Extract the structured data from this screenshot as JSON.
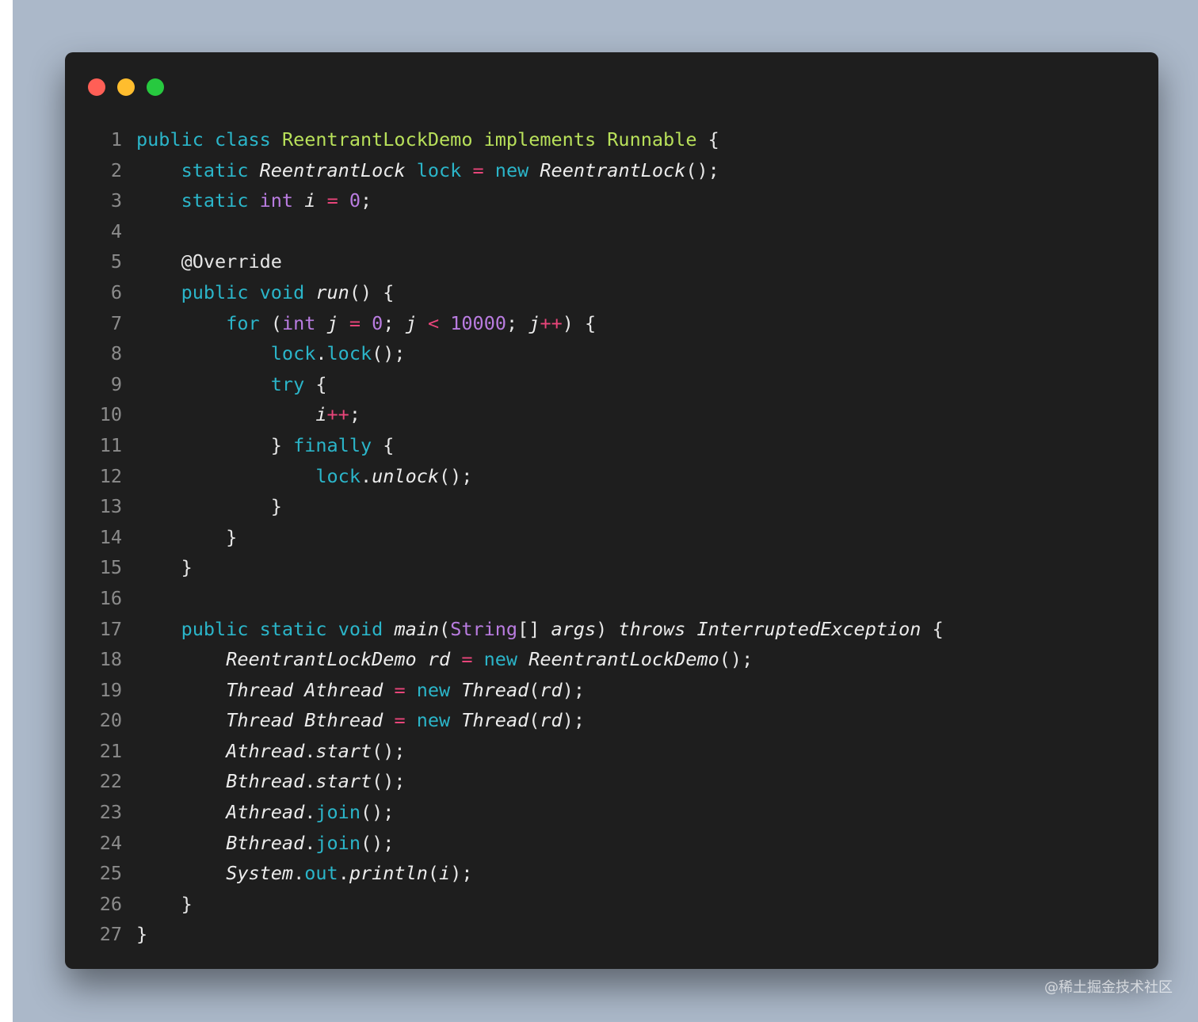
{
  "window_controls": {
    "close_color": "#ff5f56",
    "minimize_color": "#ffbd2e",
    "maximize_color": "#27c93f"
  },
  "code_lines": [
    {
      "n": "1",
      "t": [
        [
          "kw",
          "public"
        ],
        [
          "p",
          " "
        ],
        [
          "kw",
          "class"
        ],
        [
          "p",
          " "
        ],
        [
          "cls",
          "ReentrantLockDemo"
        ],
        [
          "p",
          " "
        ],
        [
          "cls",
          "implements"
        ],
        [
          "p",
          " "
        ],
        [
          "cls",
          "Runnable"
        ],
        [
          "p",
          " {"
        ]
      ]
    },
    {
      "n": "2",
      "t": [
        [
          "p",
          "    "
        ],
        [
          "kw",
          "static"
        ],
        [
          "p",
          " "
        ],
        [
          "it",
          "ReentrantLock"
        ],
        [
          "p",
          " "
        ],
        [
          "var",
          "lock"
        ],
        [
          "p",
          " "
        ],
        [
          "op",
          "="
        ],
        [
          "p",
          " "
        ],
        [
          "kw",
          "new"
        ],
        [
          "p",
          " "
        ],
        [
          "it",
          "ReentrantLock"
        ],
        [
          "p",
          "();"
        ]
      ]
    },
    {
      "n": "3",
      "t": [
        [
          "p",
          "    "
        ],
        [
          "kw",
          "static"
        ],
        [
          "p",
          " "
        ],
        [
          "type",
          "int"
        ],
        [
          "p",
          " "
        ],
        [
          "it",
          "i"
        ],
        [
          "p",
          " "
        ],
        [
          "op",
          "="
        ],
        [
          "p",
          " "
        ],
        [
          "num",
          "0"
        ],
        [
          "p",
          ";"
        ]
      ]
    },
    {
      "n": "4",
      "t": []
    },
    {
      "n": "5",
      "t": [
        [
          "p",
          "    @Override"
        ]
      ]
    },
    {
      "n": "6",
      "t": [
        [
          "p",
          "    "
        ],
        [
          "kw",
          "public"
        ],
        [
          "p",
          " "
        ],
        [
          "kw",
          "void"
        ],
        [
          "p",
          " "
        ],
        [
          "it",
          "run"
        ],
        [
          "p",
          "() {"
        ]
      ]
    },
    {
      "n": "7",
      "t": [
        [
          "p",
          "        "
        ],
        [
          "kw",
          "for"
        ],
        [
          "p",
          " ("
        ],
        [
          "type",
          "int"
        ],
        [
          "p",
          " "
        ],
        [
          "it",
          "j"
        ],
        [
          "p",
          " "
        ],
        [
          "op",
          "="
        ],
        [
          "p",
          " "
        ],
        [
          "num",
          "0"
        ],
        [
          "p",
          "; "
        ],
        [
          "it",
          "j"
        ],
        [
          "p",
          " "
        ],
        [
          "op",
          "<"
        ],
        [
          "p",
          " "
        ],
        [
          "num",
          "10000"
        ],
        [
          "p",
          "; "
        ],
        [
          "it",
          "j"
        ],
        [
          "op",
          "++"
        ],
        [
          "p",
          ") {"
        ]
      ]
    },
    {
      "n": "8",
      "t": [
        [
          "p",
          "            "
        ],
        [
          "var",
          "lock"
        ],
        [
          "p",
          "."
        ],
        [
          "var",
          "lock"
        ],
        [
          "p",
          "();"
        ]
      ]
    },
    {
      "n": "9",
      "t": [
        [
          "p",
          "            "
        ],
        [
          "kw",
          "try"
        ],
        [
          "p",
          " {"
        ]
      ]
    },
    {
      "n": "10",
      "t": [
        [
          "p",
          "                "
        ],
        [
          "it",
          "i"
        ],
        [
          "op",
          "++"
        ],
        [
          "p",
          ";"
        ]
      ]
    },
    {
      "n": "11",
      "t": [
        [
          "p",
          "            } "
        ],
        [
          "kw",
          "finally"
        ],
        [
          "p",
          " {"
        ]
      ]
    },
    {
      "n": "12",
      "t": [
        [
          "p",
          "                "
        ],
        [
          "var",
          "lock"
        ],
        [
          "p",
          "."
        ],
        [
          "it",
          "unlock"
        ],
        [
          "p",
          "();"
        ]
      ]
    },
    {
      "n": "13",
      "t": [
        [
          "p",
          "            }"
        ]
      ]
    },
    {
      "n": "14",
      "t": [
        [
          "p",
          "        }"
        ]
      ]
    },
    {
      "n": "15",
      "t": [
        [
          "p",
          "    }"
        ]
      ]
    },
    {
      "n": "16",
      "t": []
    },
    {
      "n": "17",
      "t": [
        [
          "p",
          "    "
        ],
        [
          "kw",
          "public"
        ],
        [
          "p",
          " "
        ],
        [
          "kw",
          "static"
        ],
        [
          "p",
          " "
        ],
        [
          "kw",
          "void"
        ],
        [
          "p",
          " "
        ],
        [
          "it",
          "main"
        ],
        [
          "p",
          "("
        ],
        [
          "type",
          "String"
        ],
        [
          "p",
          "[] "
        ],
        [
          "it",
          "args"
        ],
        [
          "p",
          ") "
        ],
        [
          "it",
          "throws"
        ],
        [
          "p",
          " "
        ],
        [
          "it",
          "InterruptedException"
        ],
        [
          "p",
          " {"
        ]
      ]
    },
    {
      "n": "18",
      "t": [
        [
          "p",
          "        "
        ],
        [
          "it",
          "ReentrantLockDemo"
        ],
        [
          "p",
          " "
        ],
        [
          "it",
          "rd"
        ],
        [
          "p",
          " "
        ],
        [
          "op",
          "="
        ],
        [
          "p",
          " "
        ],
        [
          "kw",
          "new"
        ],
        [
          "p",
          " "
        ],
        [
          "it",
          "ReentrantLockDemo"
        ],
        [
          "p",
          "();"
        ]
      ]
    },
    {
      "n": "19",
      "t": [
        [
          "p",
          "        "
        ],
        [
          "it",
          "Thread"
        ],
        [
          "p",
          " "
        ],
        [
          "it",
          "Athread"
        ],
        [
          "p",
          " "
        ],
        [
          "op",
          "="
        ],
        [
          "p",
          " "
        ],
        [
          "kw",
          "new"
        ],
        [
          "p",
          " "
        ],
        [
          "it",
          "Thread"
        ],
        [
          "p",
          "("
        ],
        [
          "it",
          "rd"
        ],
        [
          "p",
          ");"
        ]
      ]
    },
    {
      "n": "20",
      "t": [
        [
          "p",
          "        "
        ],
        [
          "it",
          "Thread"
        ],
        [
          "p",
          " "
        ],
        [
          "it",
          "Bthread"
        ],
        [
          "p",
          " "
        ],
        [
          "op",
          "="
        ],
        [
          "p",
          " "
        ],
        [
          "kw",
          "new"
        ],
        [
          "p",
          " "
        ],
        [
          "it",
          "Thread"
        ],
        [
          "p",
          "("
        ],
        [
          "it",
          "rd"
        ],
        [
          "p",
          ");"
        ]
      ]
    },
    {
      "n": "21",
      "t": [
        [
          "p",
          "        "
        ],
        [
          "it",
          "Athread"
        ],
        [
          "p",
          "."
        ],
        [
          "it",
          "start"
        ],
        [
          "p",
          "();"
        ]
      ]
    },
    {
      "n": "22",
      "t": [
        [
          "p",
          "        "
        ],
        [
          "it",
          "Bthread"
        ],
        [
          "p",
          "."
        ],
        [
          "it",
          "start"
        ],
        [
          "p",
          "();"
        ]
      ]
    },
    {
      "n": "23",
      "t": [
        [
          "p",
          "        "
        ],
        [
          "it",
          "Athread"
        ],
        [
          "p",
          "."
        ],
        [
          "var",
          "join"
        ],
        [
          "p",
          "();"
        ]
      ]
    },
    {
      "n": "24",
      "t": [
        [
          "p",
          "        "
        ],
        [
          "it",
          "Bthread"
        ],
        [
          "p",
          "."
        ],
        [
          "var",
          "join"
        ],
        [
          "p",
          "();"
        ]
      ]
    },
    {
      "n": "25",
      "t": [
        [
          "p",
          "        "
        ],
        [
          "it",
          "System"
        ],
        [
          "p",
          "."
        ],
        [
          "var",
          "out"
        ],
        [
          "p",
          "."
        ],
        [
          "it",
          "println"
        ],
        [
          "p",
          "("
        ],
        [
          "it",
          "i"
        ],
        [
          "p",
          ");"
        ]
      ]
    },
    {
      "n": "26",
      "t": [
        [
          "p",
          "    }"
        ]
      ]
    },
    {
      "n": "27",
      "t": [
        [
          "p",
          "}"
        ]
      ]
    }
  ],
  "watermark": "@稀土掘金技术社区"
}
